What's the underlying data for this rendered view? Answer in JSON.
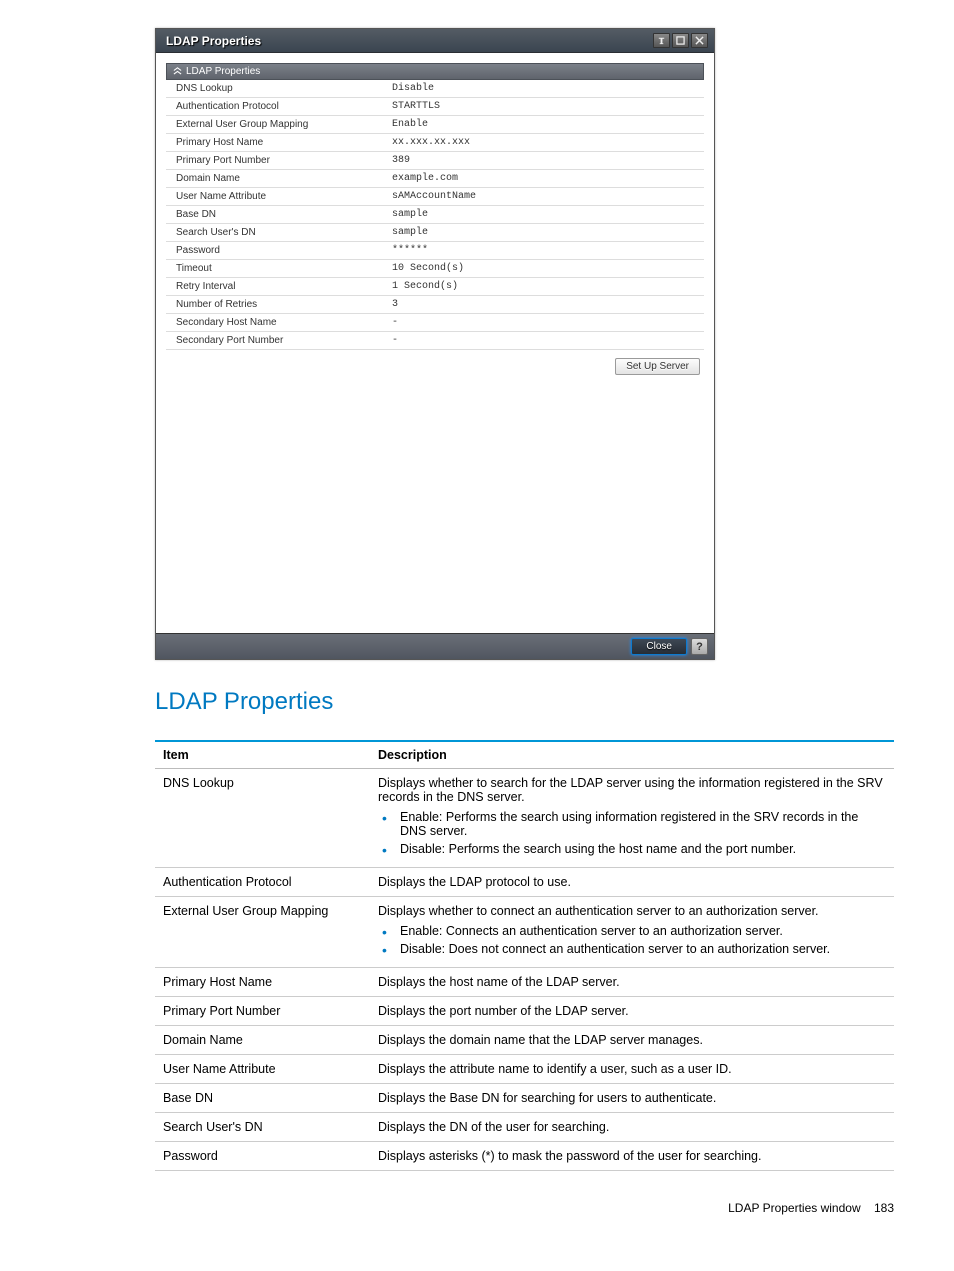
{
  "dialog": {
    "title": "LDAP Properties",
    "section_title": "LDAP Properties",
    "rows": [
      {
        "label": "DNS Lookup",
        "value": "Disable"
      },
      {
        "label": "Authentication Protocol",
        "value": "STARTTLS"
      },
      {
        "label": "External User Group Mapping",
        "value": "Enable"
      },
      {
        "label": "Primary Host Name",
        "value": "xx.xxx.xx.xxx"
      },
      {
        "label": "Primary Port Number",
        "value": "389"
      },
      {
        "label": "Domain Name",
        "value": "example.com"
      },
      {
        "label": "User Name Attribute",
        "value": "sAMAccountName"
      },
      {
        "label": "Base DN",
        "value": "sample"
      },
      {
        "label": "Search User's DN",
        "value": "sample"
      },
      {
        "label": "Password",
        "value": "******"
      },
      {
        "label": "Timeout",
        "value": "10 Second(s)"
      },
      {
        "label": "Retry Interval",
        "value": "1 Second(s)"
      },
      {
        "label": "Number of Retries",
        "value": "3"
      },
      {
        "label": "Secondary Host Name",
        "value": "-"
      },
      {
        "label": "Secondary Port Number",
        "value": "-"
      }
    ],
    "setup_button": "Set Up Server",
    "close_button": "Close",
    "help_symbol": "?"
  },
  "doc": {
    "heading": "LDAP Properties",
    "columns": {
      "item": "Item",
      "desc": "Description"
    },
    "items": [
      {
        "item": "DNS Lookup",
        "desc": "Displays whether to search for the LDAP server using the information registered in the SRV records in the DNS server.",
        "bullets": [
          "Enable: Performs the search using information registered in the SRV records in the DNS server.",
          "Disable: Performs the search using the host name and the port number."
        ]
      },
      {
        "item": "Authentication Protocol",
        "desc": "Displays the LDAP protocol to use."
      },
      {
        "item": "External User Group Mapping",
        "desc": "Displays whether to connect an authentication server to an authorization server.",
        "bullets": [
          "Enable: Connects an authentication server to an authorization server.",
          "Disable: Does not connect an authentication server to an authorization server."
        ]
      },
      {
        "item": "Primary Host Name",
        "desc": "Displays the host name of the LDAP server."
      },
      {
        "item": "Primary Port Number",
        "desc": "Displays the port number of the LDAP server."
      },
      {
        "item": "Domain Name",
        "desc": "Displays the domain name that the LDAP server manages."
      },
      {
        "item": "User Name Attribute",
        "desc": "Displays the attribute name to identify a user, such as a user ID."
      },
      {
        "item": "Base DN",
        "desc": "Displays the Base DN for searching for users to authenticate."
      },
      {
        "item": "Search User's DN",
        "desc": "Displays the DN of the user for searching."
      },
      {
        "item": "Password",
        "desc": "Displays asterisks (*) to mask the password of the user for searching."
      }
    ],
    "footer_label": "LDAP Properties window",
    "footer_page": "183"
  }
}
